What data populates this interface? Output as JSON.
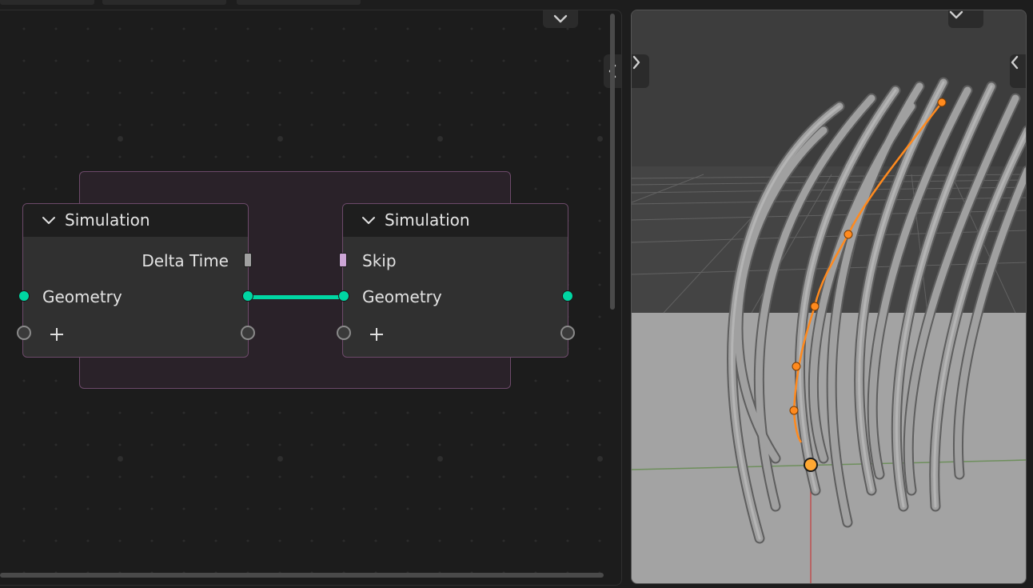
{
  "node_editor": {
    "zone_nodes": [
      {
        "id": "input",
        "title": "Simulation",
        "output_label": "Delta Time",
        "geometry_label": "Geometry"
      },
      {
        "id": "output",
        "title": "Simulation",
        "input_label": "Skip",
        "geometry_label": "Geometry"
      }
    ]
  },
  "icons": {
    "collapse": "chevron-down-icon",
    "expand": "chevron-right-icon",
    "sidebar": "chevron-left-icon",
    "add_socket": "plus-icon"
  },
  "colors": {
    "geometry_socket": "#00d6a3",
    "float_socket": "#a1a1a1",
    "bool_socket": "#cca6d6",
    "zone_frame": "#6d4a6a",
    "hair": "#a0a0a0",
    "selected_curve": "#ff8a1e"
  }
}
